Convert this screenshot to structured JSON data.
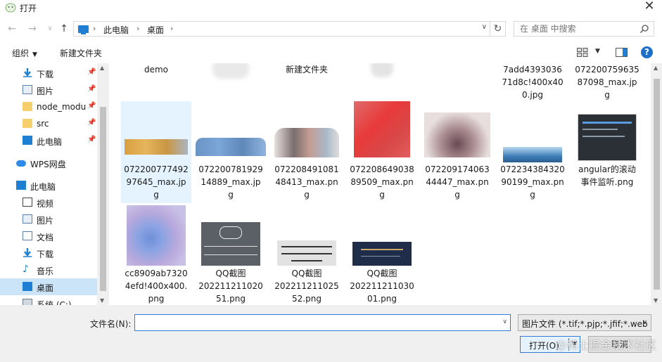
{
  "window": {
    "title": "打开"
  },
  "address": {
    "crumbs": [
      "此电脑",
      "桌面"
    ],
    "search_placeholder": "在 桌面 中搜索"
  },
  "toolbar": {
    "organize": "组织",
    "new_folder": "新建文件夹"
  },
  "nav": {
    "items": [
      {
        "label": "下载",
        "icon": "download-arrow-icon",
        "pinned": true
      },
      {
        "label": "图片",
        "icon": "pictures-icon",
        "pinned": true
      },
      {
        "label": "node_modu",
        "icon": "folder-icon",
        "pinned": true
      },
      {
        "label": "src",
        "icon": "folder-icon",
        "pinned": true
      },
      {
        "label": "此电脑",
        "icon": "pc-icon",
        "pinned": true
      },
      {
        "label": "WPS网盘",
        "icon": "cloud-icon",
        "pinned": false
      },
      {
        "label": "此电脑",
        "icon": "pc-icon",
        "pinned": false
      },
      {
        "label": "视频",
        "icon": "video-icon",
        "pinned": false
      },
      {
        "label": "图片",
        "icon": "pictures-icon",
        "pinned": false
      },
      {
        "label": "文档",
        "icon": "document-icon",
        "pinned": false
      },
      {
        "label": "下载",
        "icon": "download-arrow-icon",
        "pinned": false
      },
      {
        "label": "音乐",
        "icon": "music-icon",
        "pinned": false
      },
      {
        "label": "桌面",
        "icon": "desktop-icon",
        "pinned": false,
        "selected": true
      },
      {
        "label": "系统 (C:)",
        "icon": "drive-icon",
        "pinned": false
      }
    ]
  },
  "files": {
    "row1": [
      {
        "name": "demo"
      },
      {
        "name": ""
      },
      {
        "name": "新建文件夹"
      },
      {
        "name": ""
      },
      {
        "name": ""
      },
      {
        "name": "7add4393036\n71d8c!400x40\n0.jpg"
      },
      {
        "name": "072200759635\n87098_max.jp\ng"
      }
    ],
    "row2": [
      {
        "name": "072200777492\n97645_max.jp\ng"
      },
      {
        "name": "072200781929\n14889_max.jp\ng"
      },
      {
        "name": "072208491081\n48413_max.pn\ng"
      },
      {
        "name": "072208649038\n89509_max.pn\ng"
      },
      {
        "name": "072209174063\n44447_max.pn\ng"
      },
      {
        "name": "072234384320\n90199_max.pn\ng"
      },
      {
        "name": "angular的滚动\n事件监听.png"
      }
    ],
    "row3": [
      {
        "name": "cc8909ab7320\n4efd!400x400.\npng"
      },
      {
        "name": "QQ截图\n202211211020\n51.png"
      },
      {
        "name": "QQ截图\n202211211025\n52.png"
      },
      {
        "name": "QQ截图\n202211211030\n01.png"
      }
    ]
  },
  "bottom": {
    "filename_label": "文件名(N):",
    "filename_value": "",
    "filetype": "图片文件 (*.tif;*.pjp;*.jfif;*.web",
    "open_label": "打开(O)",
    "cancel_label": "取消",
    "watermark": "@稀土掘金技术社区"
  },
  "colors": {
    "accent": "#2f7ad8",
    "selected": "#cce4f7",
    "chrome": "#f0f0f0"
  }
}
